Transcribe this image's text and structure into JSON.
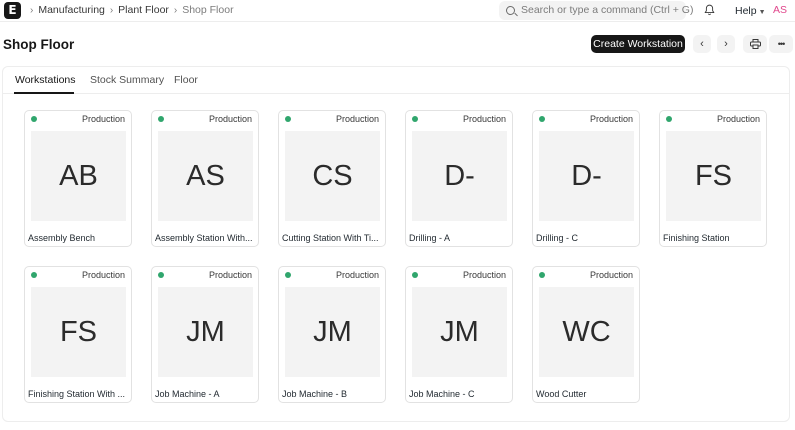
{
  "navbar": {
    "logo": "E",
    "breadcrumbs": [
      "Manufacturing",
      "Plant Floor",
      "Shop Floor"
    ],
    "search_placeholder": "Search or type a command (Ctrl + G)",
    "help_label": "Help",
    "avatar_initials": "AS"
  },
  "page": {
    "title": "Shop Floor",
    "primary_action": "Create Workstation"
  },
  "tabs": [
    "Workstations",
    "Stock Summary",
    "Floor"
  ],
  "workstations": [
    {
      "status": "Production",
      "initials": "AB",
      "name": "Assembly Bench"
    },
    {
      "status": "Production",
      "initials": "AS",
      "name": "Assembly Station With..."
    },
    {
      "status": "Production",
      "initials": "CS",
      "name": "Cutting Station With Ti..."
    },
    {
      "status": "Production",
      "initials": "D-",
      "name": "Drilling - A"
    },
    {
      "status": "Production",
      "initials": "D-",
      "name": "Drilling - C"
    },
    {
      "status": "Production",
      "initials": "FS",
      "name": "Finishing Station"
    },
    {
      "status": "Production",
      "initials": "FS",
      "name": "Finishing Station With ..."
    },
    {
      "status": "Production",
      "initials": "JM",
      "name": "Job Machine - A"
    },
    {
      "status": "Production",
      "initials": "JM",
      "name": "Job Machine - B"
    },
    {
      "status": "Production",
      "initials": "JM",
      "name": "Job Machine - C"
    },
    {
      "status": "Production",
      "initials": "WC",
      "name": "Wood Cutter"
    }
  ],
  "colors": {
    "status_dot": "#30a66d",
    "primary_button": "#171717",
    "avatar_text": "#e0478c"
  }
}
